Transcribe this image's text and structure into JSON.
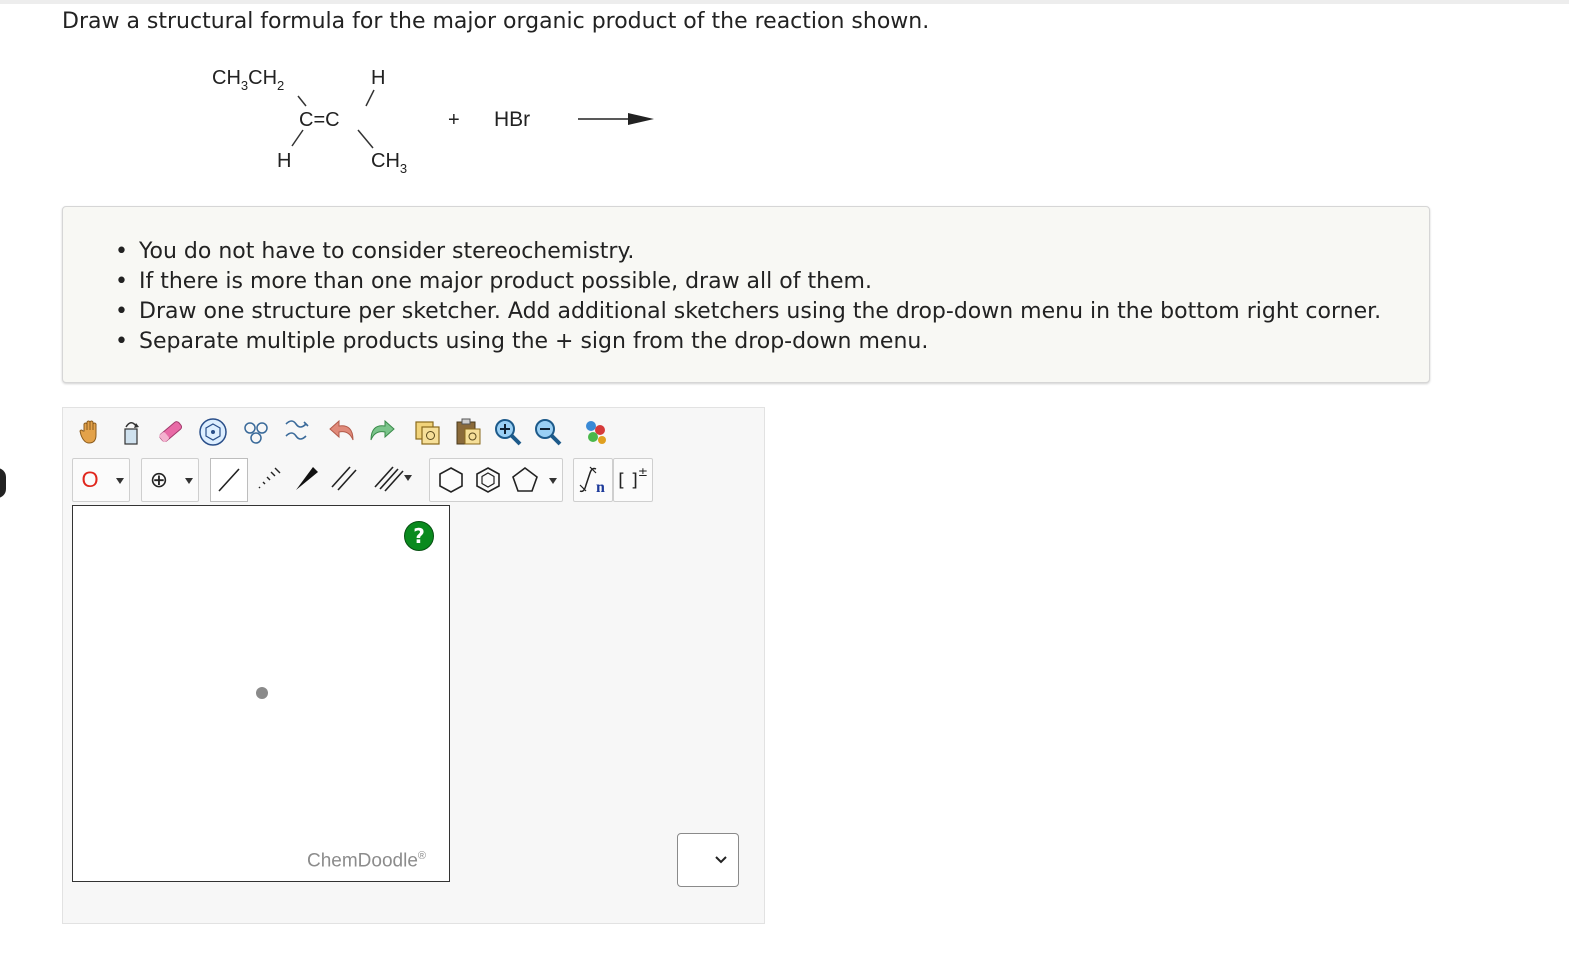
{
  "question": "Draw a structural formula for the major organic product of the reaction shown.",
  "reaction": {
    "reactant": {
      "top_left": [
        "CH",
        "3",
        "CH",
        "2"
      ],
      "top_right": "H",
      "double_bond": "C=C",
      "bottom_left": "H",
      "bottom_right": [
        "CH",
        "3"
      ]
    },
    "plus": "+",
    "reagent": "HBr"
  },
  "instructions": [
    "You do not have to consider stereochemistry.",
    "If there is more than one major product possible, draw all of them.",
    "Draw one structure per sketcher. Add additional sketchers using the drop-down menu in the bottom right corner.",
    "Separate multiple products using the + sign from the drop-down menu."
  ],
  "sketcher": {
    "atom_tool_label": "O",
    "charge_tool_label": "⊕",
    "bracket_label": "[ ]",
    "bracket_sup": "±",
    "repeat_label": "n",
    "help_label": "?",
    "brand": "ChemDoodle",
    "brand_mark": "®",
    "colors": {
      "help": "#0a8a1e",
      "atom_label": "#e0261c"
    }
  }
}
